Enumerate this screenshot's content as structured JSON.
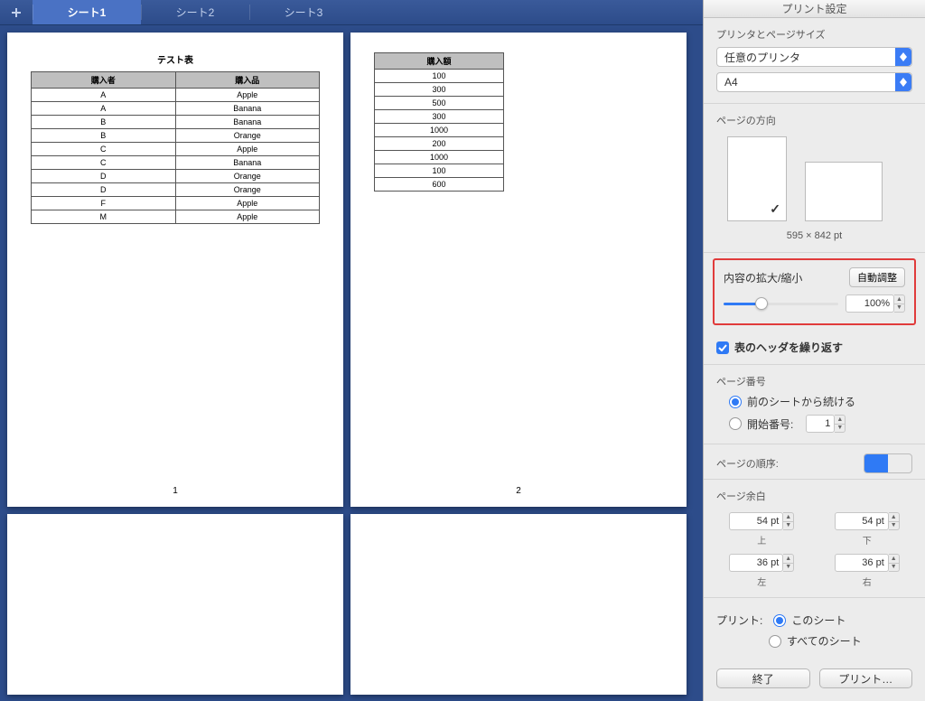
{
  "tabs": {
    "add_tooltip": "新規シート",
    "items": [
      "シート1",
      "シート2",
      "シート3"
    ],
    "active_index": 0
  },
  "preview": {
    "title": "テスト表",
    "page1": {
      "headers": [
        "購入者",
        "購入品"
      ],
      "rows": [
        [
          "A",
          "Apple"
        ],
        [
          "A",
          "Banana"
        ],
        [
          "B",
          "Banana"
        ],
        [
          "B",
          "Orange"
        ],
        [
          "C",
          "Apple"
        ],
        [
          "C",
          "Banana"
        ],
        [
          "D",
          "Orange"
        ],
        [
          "D",
          "Orange"
        ],
        [
          "F",
          "Apple"
        ],
        [
          "M",
          "Apple"
        ]
      ],
      "page_number": "1"
    },
    "page2": {
      "headers": [
        "購入額"
      ],
      "rows": [
        [
          "100"
        ],
        [
          "300"
        ],
        [
          "500"
        ],
        [
          "300"
        ],
        [
          "1000"
        ],
        [
          "200"
        ],
        [
          "1000"
        ],
        [
          "100"
        ],
        [
          "600"
        ]
      ],
      "page_number": "2"
    }
  },
  "panel": {
    "title": "プリント設定",
    "printer_size_label": "プリンタとページサイズ",
    "printer": "任意のプリンタ",
    "paper": "A4",
    "orientation_label": "ページの方向",
    "dimensions": "595 × 842 pt",
    "scale": {
      "label": "内容の拡大/縮小",
      "auto_button": "自動調整",
      "value": "100%"
    },
    "repeat_headers": "表のヘッダを繰り返す",
    "page_number": {
      "label": "ページ番号",
      "continue": "前のシートから続ける",
      "start_at": "開始番号:",
      "start_value": "1"
    },
    "page_order_label": "ページの順序:",
    "margins": {
      "label": "ページ余白",
      "top_value": "54 pt",
      "top_label": "上",
      "bottom_value": "54 pt",
      "bottom_label": "下",
      "left_value": "36 pt",
      "left_label": "左",
      "right_value": "36 pt",
      "right_label": "右"
    },
    "print_scope": {
      "label": "プリント:",
      "this_sheet": "このシート",
      "all_sheets": "すべてのシート"
    },
    "footer": {
      "done": "終了",
      "print": "プリント…"
    }
  }
}
